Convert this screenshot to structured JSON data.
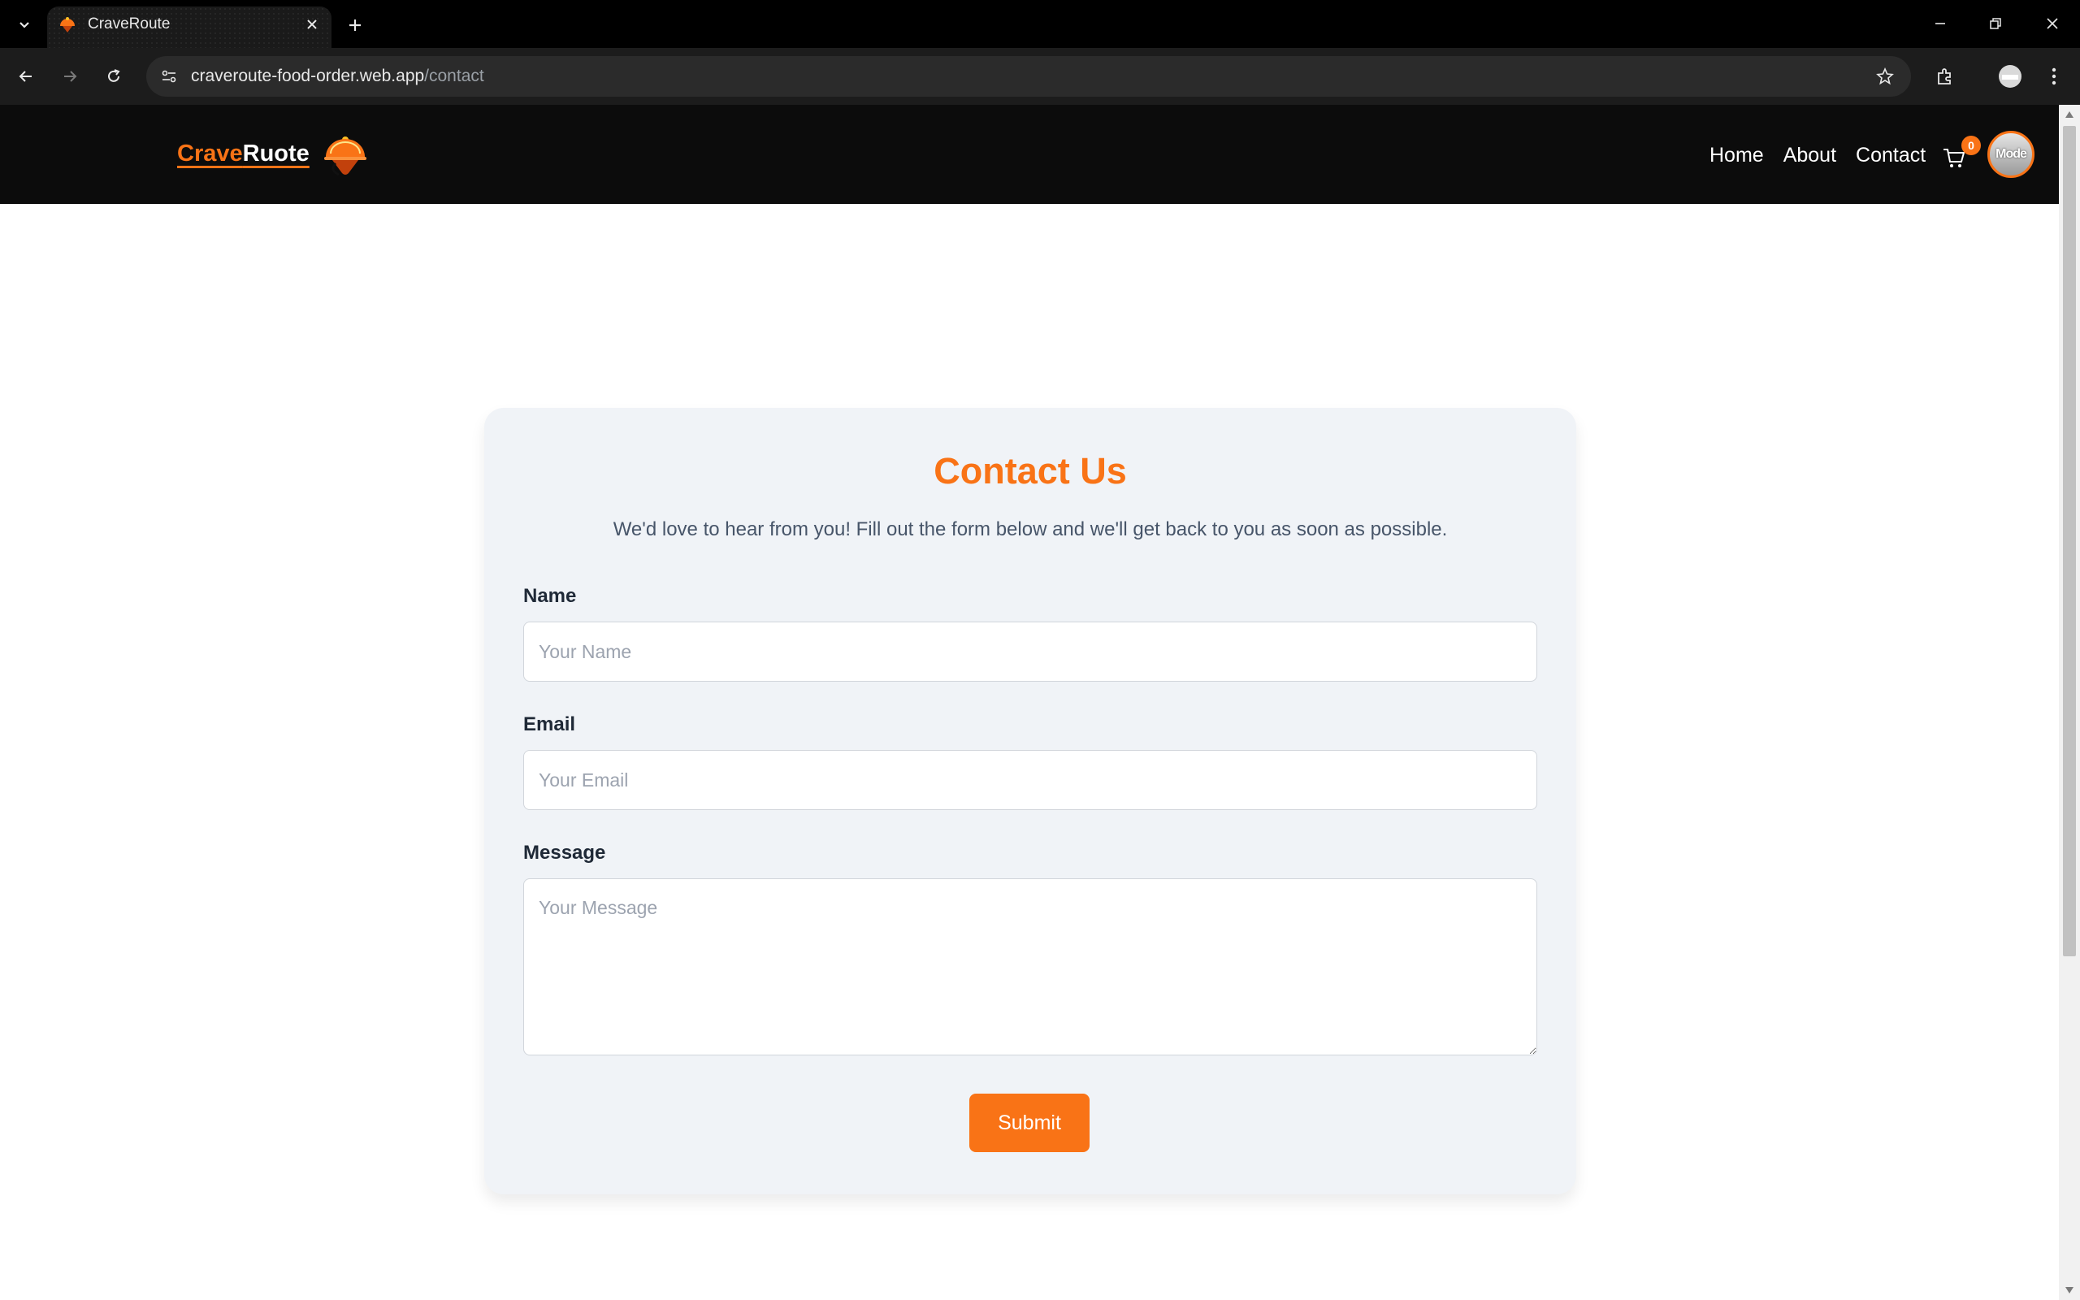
{
  "browser": {
    "tab_title": "CraveRoute",
    "url_domain": "craveroute-food-order.web.app",
    "url_path": "/contact",
    "icons": [
      "tab-list-icon",
      "close-icon",
      "plus-icon",
      "minimize-icon",
      "restore-icon",
      "window-close-icon",
      "back-icon",
      "forward-icon",
      "reload-icon",
      "site-info-icon",
      "star-icon",
      "extensions-icon",
      "profile-icon",
      "more-icon"
    ]
  },
  "nav": {
    "brand_part1": "Crave",
    "brand_part2": "Ruote",
    "links": [
      "Home",
      "About",
      "Contact"
    ],
    "cart_count": "0",
    "avatar_text": "Mode"
  },
  "contact": {
    "title": "Contact Us",
    "subtitle": "We'd love to hear from you! Fill out the form below and we'll get back to you as soon as possible.",
    "name_label": "Name",
    "name_placeholder": "Your Name",
    "name_value": "",
    "email_label": "Email",
    "email_placeholder": "Your Email",
    "email_value": "",
    "message_label": "Message",
    "message_placeholder": "Your Message",
    "message_value": "",
    "submit_label": "Submit"
  },
  "colors": {
    "accent": "#f97316",
    "navbar": "#0c0c0c",
    "card": "#f0f3f7"
  }
}
